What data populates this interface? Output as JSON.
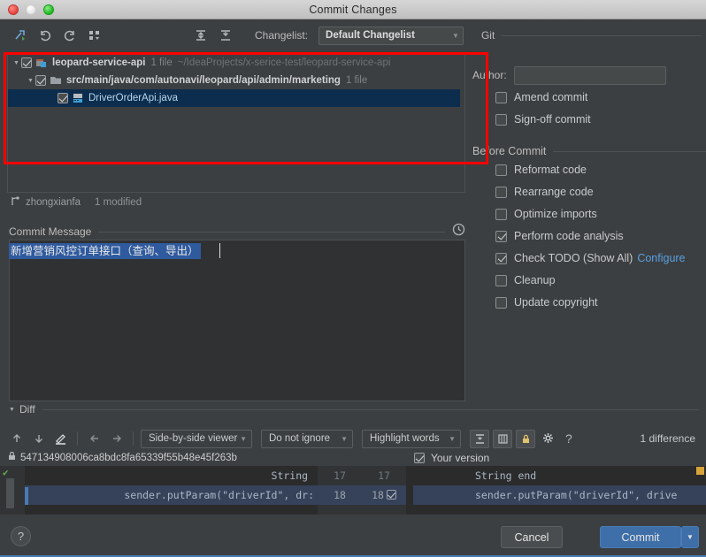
{
  "window": {
    "title": "Commit Changes",
    "traffic_lights": [
      "close-red",
      "minimize-disabled",
      "zoom-green"
    ]
  },
  "toolbar": {
    "icons": [
      "refresh-changes-icon",
      "revert-icon",
      "rollback-icon",
      "group-by-icon",
      "expand-all-icon",
      "collapse-all-icon"
    ],
    "changelist_label": "Changelist:",
    "changelist_value": "Default Changelist",
    "git_label": "Git"
  },
  "file_tree": {
    "rows": [
      {
        "indent": 0,
        "expanded": true,
        "checked": true,
        "icon": "module-icon",
        "name": "leopard-service-api",
        "count": "1 file",
        "path": "~/IdeaProjects/x-serice-test/leopard-service-api",
        "selected": false
      },
      {
        "indent": 1,
        "expanded": true,
        "checked": true,
        "icon": "folder-icon",
        "name": "src/main/java/com/autonavi/leopard/api/admin/marketing",
        "count": "1 file",
        "path": "",
        "selected": false
      },
      {
        "indent": 2,
        "expanded": null,
        "checked": true,
        "icon": "java-file-icon",
        "name": "DriverOrderApi.java",
        "count": "",
        "path": "",
        "selected": true
      }
    ]
  },
  "branch": {
    "icon": "branch-icon",
    "name": "zhongxianfa",
    "modified": "1 modified"
  },
  "commit_message": {
    "label": "Commit Message",
    "history_icon": "clock-icon",
    "value": "新增营销风控订单接口（查询、导出）",
    "placeholder": ""
  },
  "right_panel": {
    "author_label": "Author:",
    "author_value": "",
    "options": [
      {
        "label": "Amend commit",
        "checked": false
      },
      {
        "label": "Sign-off commit",
        "checked": false
      }
    ],
    "before_commit_title": "Before Commit",
    "before_commit_options": [
      {
        "label": "Reformat code",
        "checked": false,
        "link": ""
      },
      {
        "label": "Rearrange code",
        "checked": false,
        "link": ""
      },
      {
        "label": "Optimize imports",
        "checked": false,
        "link": ""
      },
      {
        "label": "Perform code analysis",
        "checked": true,
        "link": ""
      },
      {
        "label": "Check TODO (Show All)",
        "checked": true,
        "link": "Configure"
      },
      {
        "label": "Cleanup",
        "checked": false,
        "link": ""
      },
      {
        "label": "Update copyright",
        "checked": false,
        "link": ""
      }
    ]
  },
  "diff": {
    "section_title": "Diff",
    "nav_icons": [
      "arrow-up-icon",
      "arrow-down-icon",
      "edit-pencil-icon",
      "arrow-left-icon",
      "arrow-right-icon"
    ],
    "viewer_mode": "Side-by-side viewer",
    "ignore_mode": "Do not ignore",
    "highlight_mode": "Highlight words",
    "toggle_icons": [
      "collapse-unchanged-icon",
      "show-diff-map-icon",
      "lock-icon",
      "settings-gear-icon"
    ],
    "help_icon": "help-question-icon",
    "difference_count": "1 difference",
    "left_title": {
      "lock_icon": "lock-icon",
      "revision": "547134908006ca8bdc8fa65339f55b48e45f263b"
    },
    "right_title": {
      "checked": true,
      "label": "Your version"
    },
    "lines": [
      {
        "left_code": "String ",
        "right_code": "String end",
        "left_num": "17",
        "right_num": "17",
        "changed": false,
        "accept_checkbox": false
      },
      {
        "left_code": "sender.putParam(\"driverId\", dr:",
        "right_code": "sender.putParam(\"driverId\", drive",
        "left_num": "18",
        "right_num": "18",
        "changed": true,
        "accept_checkbox": true
      }
    ]
  },
  "footer": {
    "help_label": "?",
    "cancel_label": "Cancel",
    "commit_label": "Commit",
    "commit_dropdown_icon": "chevron-down-icon"
  },
  "annotation": {
    "type": "red-rectangle-highlight",
    "color": "#ff0000"
  }
}
